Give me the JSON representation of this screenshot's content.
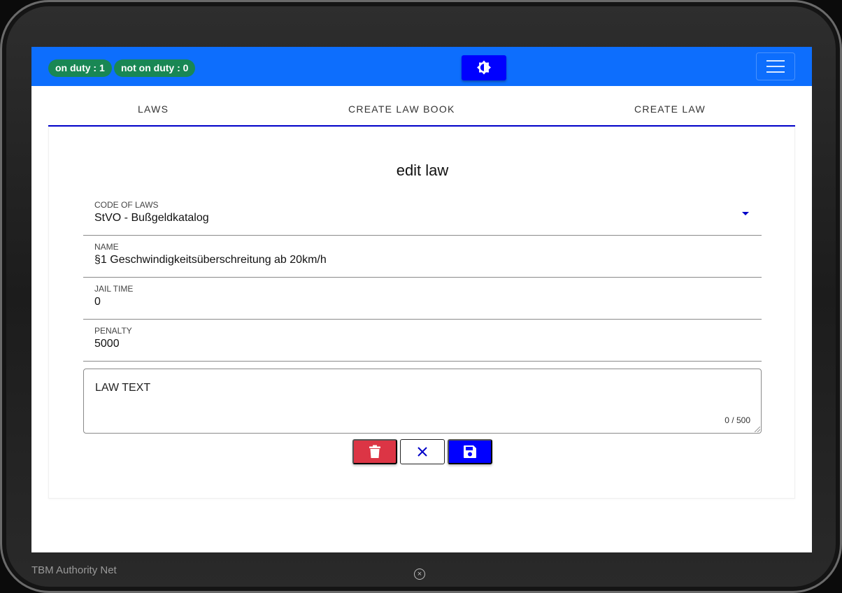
{
  "header": {
    "on_duty": "on duty : 1",
    "not_on_duty": "not on duty : 0"
  },
  "tabs": [
    {
      "label": "LAWS"
    },
    {
      "label": "CREATE LAW BOOK"
    },
    {
      "label": "CREATE LAW"
    }
  ],
  "form": {
    "title": "edit law",
    "code_of_laws": {
      "label": "CODE OF LAWS",
      "value": "StVO - Bußgeldkatalog"
    },
    "name": {
      "label": "NAME",
      "value": "§1 Geschwindigkeitsüberschreitung ab 20km/h"
    },
    "jail_time": {
      "label": "JAIL TIME",
      "value": "0"
    },
    "penalty": {
      "label": "PENALTY",
      "value": "5000"
    },
    "law_text": {
      "placeholder": "LAW TEXT",
      "counter": "0 / 500"
    }
  },
  "footer": {
    "app_name": "TBM Authority Net"
  },
  "colors": {
    "primary": "#0d6efd",
    "accent": "#0000ff",
    "success": "#198754",
    "danger": "#dc3545"
  },
  "icons": {
    "theme": "brightness-icon",
    "menu": "hamburger-icon",
    "delete": "trash-icon",
    "cancel": "close-icon",
    "save": "floppy-disk-icon",
    "dropdown": "caret-down-icon"
  }
}
